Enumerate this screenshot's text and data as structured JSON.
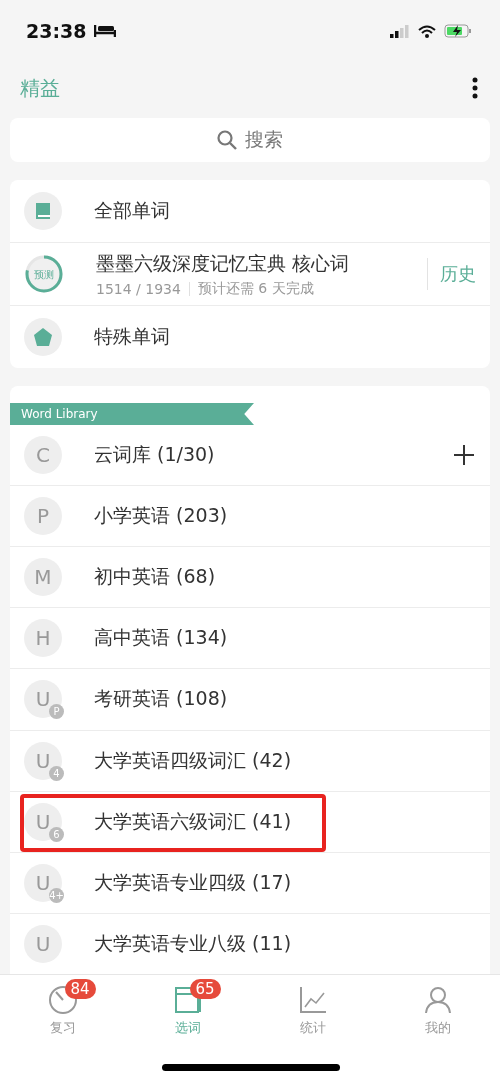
{
  "status_bar": {
    "time": "23:38"
  },
  "header": {
    "title": "精益"
  },
  "search": {
    "placeholder": "搜索"
  },
  "word_sets": [
    {
      "kind": "book",
      "label": "全部单词"
    },
    {
      "kind": "progress",
      "label": "墨墨六级深度记忆宝典 核心词",
      "ring_label": "预测",
      "level": 0.78,
      "count": "1514 / 1934",
      "estimate": "预计还需 6 天完成",
      "action": "历史"
    },
    {
      "kind": "star",
      "label": "特殊单词"
    }
  ],
  "library": {
    "banner": "Word Library",
    "items": [
      {
        "letter": "C",
        "label": "云词库 (1/30)",
        "add": true,
        "highlighted": false
      },
      {
        "letter": "P",
        "label": "小学英语 (203)",
        "add": false,
        "highlighted": false
      },
      {
        "letter": "M",
        "label": "初中英语 (68)",
        "add": false,
        "highlighted": false
      },
      {
        "letter": "H",
        "label": "高中英语 (134)",
        "add": false,
        "highlighted": false
      },
      {
        "letter": "U",
        "label": "考研英语 (108)",
        "badge": "P",
        "add": false,
        "highlighted": false
      },
      {
        "letter": "U",
        "label": "大学英语四级词汇 (42)",
        "badge": "4",
        "add": false,
        "highlighted": false
      },
      {
        "letter": "U",
        "label": "大学英语六级词汇 (41)",
        "badge": "6",
        "add": false,
        "highlighted": true
      },
      {
        "letter": "U",
        "label": "大学英语专业四级 (17)",
        "badge": "4+",
        "add": false,
        "highlighted": false
      },
      {
        "letter": "U",
        "label": "大学英语专业八级 (11)",
        "add": false,
        "highlighted": false
      }
    ]
  },
  "tabs": [
    {
      "kind": "timer",
      "label": "复习",
      "badge": "84",
      "selected": false
    },
    {
      "kind": "book",
      "label": "选词",
      "badge": "65",
      "selected": true
    },
    {
      "kind": "chart",
      "label": "统计",
      "selected": false
    },
    {
      "kind": "person",
      "label": "我的",
      "selected": false
    }
  ]
}
